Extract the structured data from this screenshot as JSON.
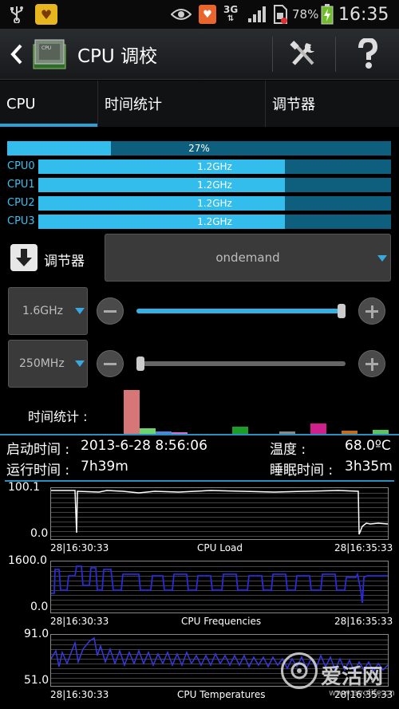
{
  "status_bar": {
    "network": "3G",
    "battery": "78%",
    "time": "16:35"
  },
  "app": {
    "title": "CPU 调校"
  },
  "tabs": [
    {
      "label": "CPU",
      "selected": true
    },
    {
      "label": "时间统计"
    },
    {
      "label": "调节器"
    }
  ],
  "overall_load": {
    "label": "27%",
    "value": 0.27
  },
  "cpus": [
    {
      "name": "CPU0",
      "freq": "1.2GHz",
      "value": 0.7
    },
    {
      "name": "CPU1",
      "freq": "1.2GHz",
      "value": 0.7
    },
    {
      "name": "CPU2",
      "freq": "1.2GHz",
      "value": 0.7
    },
    {
      "name": "CPU3",
      "freq": "1.2GHz",
      "value": 0.7
    }
  ],
  "governor": {
    "label": "调节器",
    "value": "ondemand"
  },
  "max_freq": {
    "value": "1.6GHz",
    "level": 1.0
  },
  "min_freq": {
    "value": "250MHz",
    "level": 0.0
  },
  "time_stats": {
    "label": "时间统计 :"
  },
  "info": {
    "boot_label": "启动时间 :",
    "boot_value": "2013-6-28 8:56:06",
    "temp_label": "温度 :",
    "temp_value": "68.0ºC",
    "uptime_label": "运行时间 :",
    "uptime_value": "7h39m",
    "sleep_label": "睡眠时间 :",
    "sleep_value": "3h35m"
  },
  "graphs": [
    {
      "title": "CPU Load",
      "y_max": "100.1",
      "y_min": "0.0",
      "x_start": "28|16:30:33",
      "x_end": "28|16:35:33"
    },
    {
      "title": "CPU Frequencies",
      "y_max": "1600.0",
      "y_min": "0.0",
      "x_start": "28|16:30:33",
      "x_end": "28|16:35:33"
    },
    {
      "title": "CPU Temperatures",
      "y_max": "91.0",
      "y_min": "51.0",
      "x_start": "28|16:30:33",
      "x_end": "28|16:35:33"
    }
  ],
  "watermark": {
    "text": "爱活网",
    "url": "www.evolife.cn"
  },
  "colors": {
    "accent": "#33bdec",
    "bar_track": "#0d5f7d",
    "graph_line": "#2a2ad8"
  }
}
